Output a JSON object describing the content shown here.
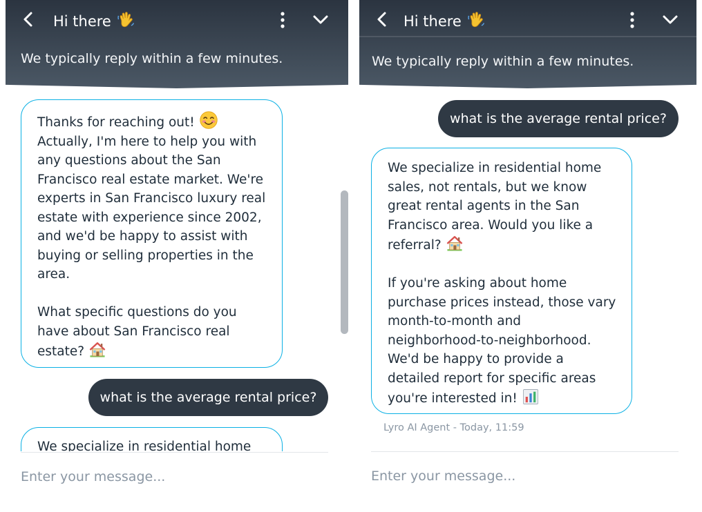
{
  "left": {
    "header": {
      "title": "Hi there",
      "subtitle": "We typically reply within a few minutes."
    },
    "messages": [
      {
        "from": "agent",
        "paragraphs": [
          "Thanks for reaching out!",
          "Actually, I'm here to help you with\nany questions about the San\nFrancisco real estate market. We're\nexperts in San Francisco luxury real\nestate with experience since 2002,\nand we'd be happy to assist with\nbuying or selling properties in the\narea.",
          "What specific questions do you\nhave about San Francisco real\nestate?"
        ]
      },
      {
        "from": "user",
        "text": "what is the average rental price?"
      },
      {
        "from": "agent",
        "text_partial": "We specialize in residential home"
      }
    ],
    "composer": {
      "placeholder": "Enter your message..."
    }
  },
  "right": {
    "header": {
      "title": "Hi there",
      "subtitle": "We typically reply within a few minutes."
    },
    "messages": [
      {
        "from": "user",
        "text": "what is the average rental price?"
      },
      {
        "from": "agent",
        "paragraphs": [
          "We specialize in residential home\nsales, not rentals, but we know\ngreat rental agents in the San\nFrancisco area. Would you like a\nreferral?",
          "If you're asking about home\npurchase prices instead, those vary\nmonth-to-month and\nneighborhood-to-neighborhood.\nWe'd be happy to provide a\ndetailed report for specific areas\nyou're interested in!"
        ],
        "meta": "Lyro AI Agent - Today, 11:59"
      }
    ],
    "composer": {
      "placeholder": "Enter your message..."
    }
  },
  "icons": [
    "back-icon",
    "waving-hand-icon",
    "more-vertical-icon",
    "chevron-down-icon",
    "smiling-face-icon",
    "house-icon",
    "bar-chart-icon"
  ],
  "colors": {
    "header_dark": "#2b3440",
    "header_light": "#4b5865",
    "accent_border": "#0ab0e4",
    "user_bubble": "#2f3944",
    "muted_text": "#8a96a3"
  }
}
